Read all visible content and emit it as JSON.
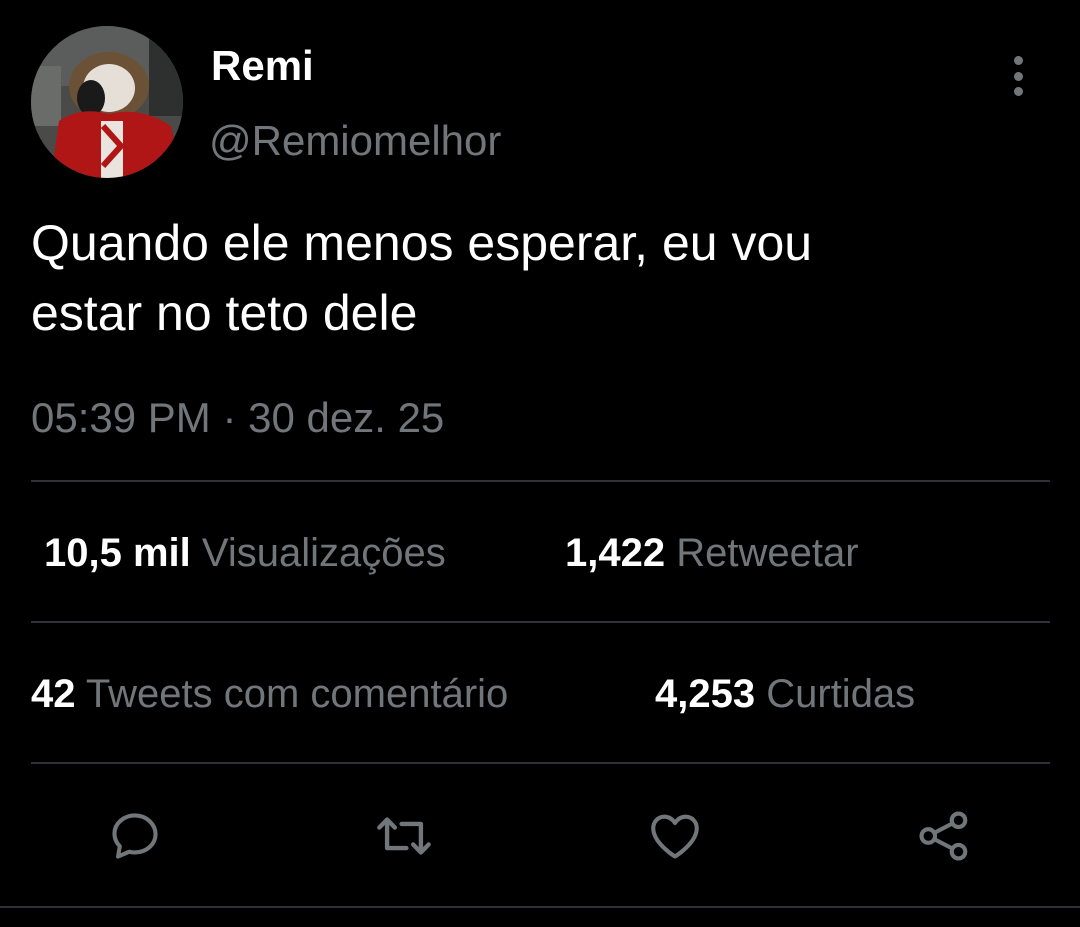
{
  "author": {
    "name": "Remi",
    "handle": "@Remiomelhor",
    "avatar_icon": "profile-photo"
  },
  "tweet": {
    "line1": "Quando ele menos esperar, eu vou",
    "line2": "estar no teto dele",
    "time": "05:39 PM",
    "separator": "·",
    "date": "30 dez. 25"
  },
  "stats": {
    "views_count": "10,5 mil",
    "views_label": "Visualizações",
    "retweets_count": "1,422",
    "retweets_label": "Retweetar",
    "quotes_count": "42",
    "quotes_label": "Tweets com comentário",
    "likes_count": "4,253",
    "likes_label": "Curtidas"
  },
  "actions": {
    "reply_icon": "reply-icon",
    "retweet_icon": "retweet-icon",
    "like_icon": "heart-icon",
    "share_icon": "share-icon"
  },
  "colors": {
    "background": "#000000",
    "primary_text": "#ffffff",
    "secondary_text": "#71767b",
    "divider": "#2f3336"
  }
}
